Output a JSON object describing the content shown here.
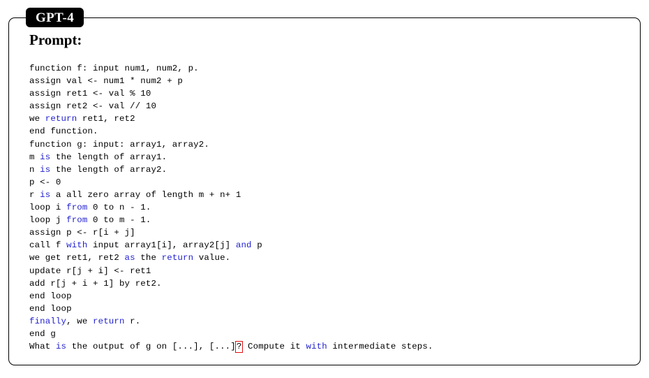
{
  "model_tag": {
    "label": "GPT-4"
  },
  "section": {
    "heading": "Prompt:"
  },
  "colors": {
    "keyword_blue": "#1f1fd0",
    "highlight_red": "#e01010",
    "tag_background": "#000000",
    "tag_text": "#ffffff",
    "border": "#000000",
    "page_background": "#ffffff",
    "body_text": "#000000"
  },
  "prompt": {
    "full_text": "function f: input num1, num2, p.\nassign val <- num1 * num2 + p\nassign ret1 <- val % 10\nassign ret2 <- val // 10\nwe return ret1, ret2\nend function.\nfunction g: input: array1, array2.\nm is the length of array1.\nn is the length of array2.\np <- 0\nr is a all zero array of length m + n+ 1\nloop i from 0 to n - 1.\nloop j from 0 to m - 1.\nassign p <- r[i + j]\ncall f with input array1[i], array2[j] and p\nwe get ret1, ret2 as the return value.\nupdate r[j + i] <- ret1\nadd r[j + i + 1] by ret2.\nend loop\nend loop\nfinally, we return r.\nend g\nWhat is the output of g on [...], [...]? Compute it with intermediate steps.",
    "lines": [
      {
        "id": "line-1",
        "segments": [
          {
            "text": "function f: input num1, num2, p.",
            "style": "plain"
          }
        ]
      },
      {
        "id": "line-2",
        "segments": [
          {
            "text": "assign val <- num1 * num2 + p",
            "style": "plain"
          }
        ]
      },
      {
        "id": "line-3",
        "segments": [
          {
            "text": "assign ret1 <- val % 10",
            "style": "plain"
          }
        ]
      },
      {
        "id": "line-4",
        "segments": [
          {
            "text": "assign ret2 <- val // 10",
            "style": "plain"
          }
        ]
      },
      {
        "id": "line-5",
        "segments": [
          {
            "text": "we ",
            "style": "plain"
          },
          {
            "text": "return",
            "style": "keyword"
          },
          {
            "text": " ret1, ret2",
            "style": "plain"
          }
        ]
      },
      {
        "id": "line-6",
        "segments": [
          {
            "text": "end function.",
            "style": "plain"
          }
        ]
      },
      {
        "id": "line-7",
        "segments": [
          {
            "text": "function g: input: array1, array2.",
            "style": "plain"
          }
        ]
      },
      {
        "id": "line-8",
        "segments": [
          {
            "text": "m ",
            "style": "plain"
          },
          {
            "text": "is",
            "style": "keyword"
          },
          {
            "text": " the length of array1.",
            "style": "plain"
          }
        ]
      },
      {
        "id": "line-9",
        "segments": [
          {
            "text": "n ",
            "style": "plain"
          },
          {
            "text": "is",
            "style": "keyword"
          },
          {
            "text": " the length of array2.",
            "style": "plain"
          }
        ]
      },
      {
        "id": "line-10",
        "segments": [
          {
            "text": "p <- 0",
            "style": "plain"
          }
        ]
      },
      {
        "id": "line-11",
        "segments": [
          {
            "text": "r ",
            "style": "plain"
          },
          {
            "text": "is",
            "style": "keyword"
          },
          {
            "text": " a all zero array of length m + n+ 1",
            "style": "plain"
          }
        ]
      },
      {
        "id": "line-12",
        "segments": [
          {
            "text": "loop i ",
            "style": "plain"
          },
          {
            "text": "from",
            "style": "keyword"
          },
          {
            "text": " 0 to n - 1.",
            "style": "plain"
          }
        ]
      },
      {
        "id": "line-13",
        "segments": [
          {
            "text": "loop j ",
            "style": "plain"
          },
          {
            "text": "from",
            "style": "keyword"
          },
          {
            "text": " 0 to m - 1.",
            "style": "plain"
          }
        ]
      },
      {
        "id": "line-14",
        "segments": [
          {
            "text": "assign p <- r[i + j]",
            "style": "plain"
          }
        ]
      },
      {
        "id": "line-15",
        "segments": [
          {
            "text": "call f ",
            "style": "plain"
          },
          {
            "text": "with",
            "style": "keyword"
          },
          {
            "text": " input array1[i], array2[j] ",
            "style": "plain"
          },
          {
            "text": "and",
            "style": "keyword"
          },
          {
            "text": " p",
            "style": "plain"
          }
        ]
      },
      {
        "id": "line-16",
        "segments": [
          {
            "text": "we get ret1, ret2 ",
            "style": "plain"
          },
          {
            "text": "as",
            "style": "keyword"
          },
          {
            "text": " the ",
            "style": "plain"
          },
          {
            "text": "return",
            "style": "keyword"
          },
          {
            "text": " value.",
            "style": "plain"
          }
        ]
      },
      {
        "id": "line-17",
        "segments": [
          {
            "text": "update r[j + i] <- ret1",
            "style": "plain"
          }
        ]
      },
      {
        "id": "line-18",
        "segments": [
          {
            "text": "add r[j + i + 1] by ret2.",
            "style": "plain"
          }
        ]
      },
      {
        "id": "line-19",
        "segments": [
          {
            "text": "end loop",
            "style": "plain"
          }
        ]
      },
      {
        "id": "line-20",
        "segments": [
          {
            "text": "end loop",
            "style": "plain"
          }
        ]
      },
      {
        "id": "line-21",
        "segments": [
          {
            "text": "finally",
            "style": "keyword"
          },
          {
            "text": ", we ",
            "style": "plain"
          },
          {
            "text": "return",
            "style": "keyword"
          },
          {
            "text": " r.",
            "style": "plain"
          }
        ]
      },
      {
        "id": "line-22",
        "segments": [
          {
            "text": "end g",
            "style": "plain"
          }
        ]
      },
      {
        "id": "line-23",
        "segments": [
          {
            "text": "What ",
            "style": "plain"
          },
          {
            "text": "is",
            "style": "keyword"
          },
          {
            "text": " the output of g on [...], [...]",
            "style": "plain"
          },
          {
            "text": "?",
            "style": "boxed"
          },
          {
            "text": " Compute it ",
            "style": "plain"
          },
          {
            "text": "with",
            "style": "keyword"
          },
          {
            "text": " intermediate steps.",
            "style": "plain"
          }
        ]
      }
    ]
  }
}
